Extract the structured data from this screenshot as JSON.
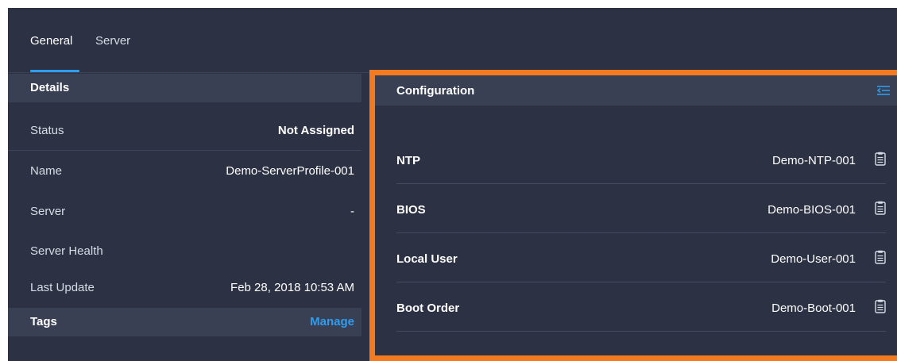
{
  "tabs": {
    "general": "General",
    "server": "Server"
  },
  "details": {
    "title": "Details",
    "rows": [
      {
        "label": "Status",
        "value": "Not Assigned"
      },
      {
        "label": "Name",
        "value": "Demo-ServerProfile-001"
      },
      {
        "label": "Server",
        "value": "-"
      },
      {
        "label": "Server Health",
        "value": ""
      },
      {
        "label": "Last Update",
        "value": "Feb 28, 2018 10:53 AM"
      }
    ]
  },
  "tags": {
    "title": "Tags",
    "manage_label": "Manage"
  },
  "configuration": {
    "title": "Configuration",
    "items": [
      {
        "label": "NTP",
        "value": "Demo-NTP-001"
      },
      {
        "label": "BIOS",
        "value": "Demo-BIOS-001"
      },
      {
        "label": "Local User",
        "value": "Demo-User-001"
      },
      {
        "label": "Boot Order",
        "value": "Demo-Boot-001"
      }
    ]
  },
  "colors": {
    "accent": "#2e9df0",
    "highlight_border": "#f47a1f",
    "panel_bg": "#2c3143",
    "header_bg": "#3a4053"
  },
  "icons": {
    "collapse": "collapse-list-icon",
    "document": "document-icon"
  }
}
